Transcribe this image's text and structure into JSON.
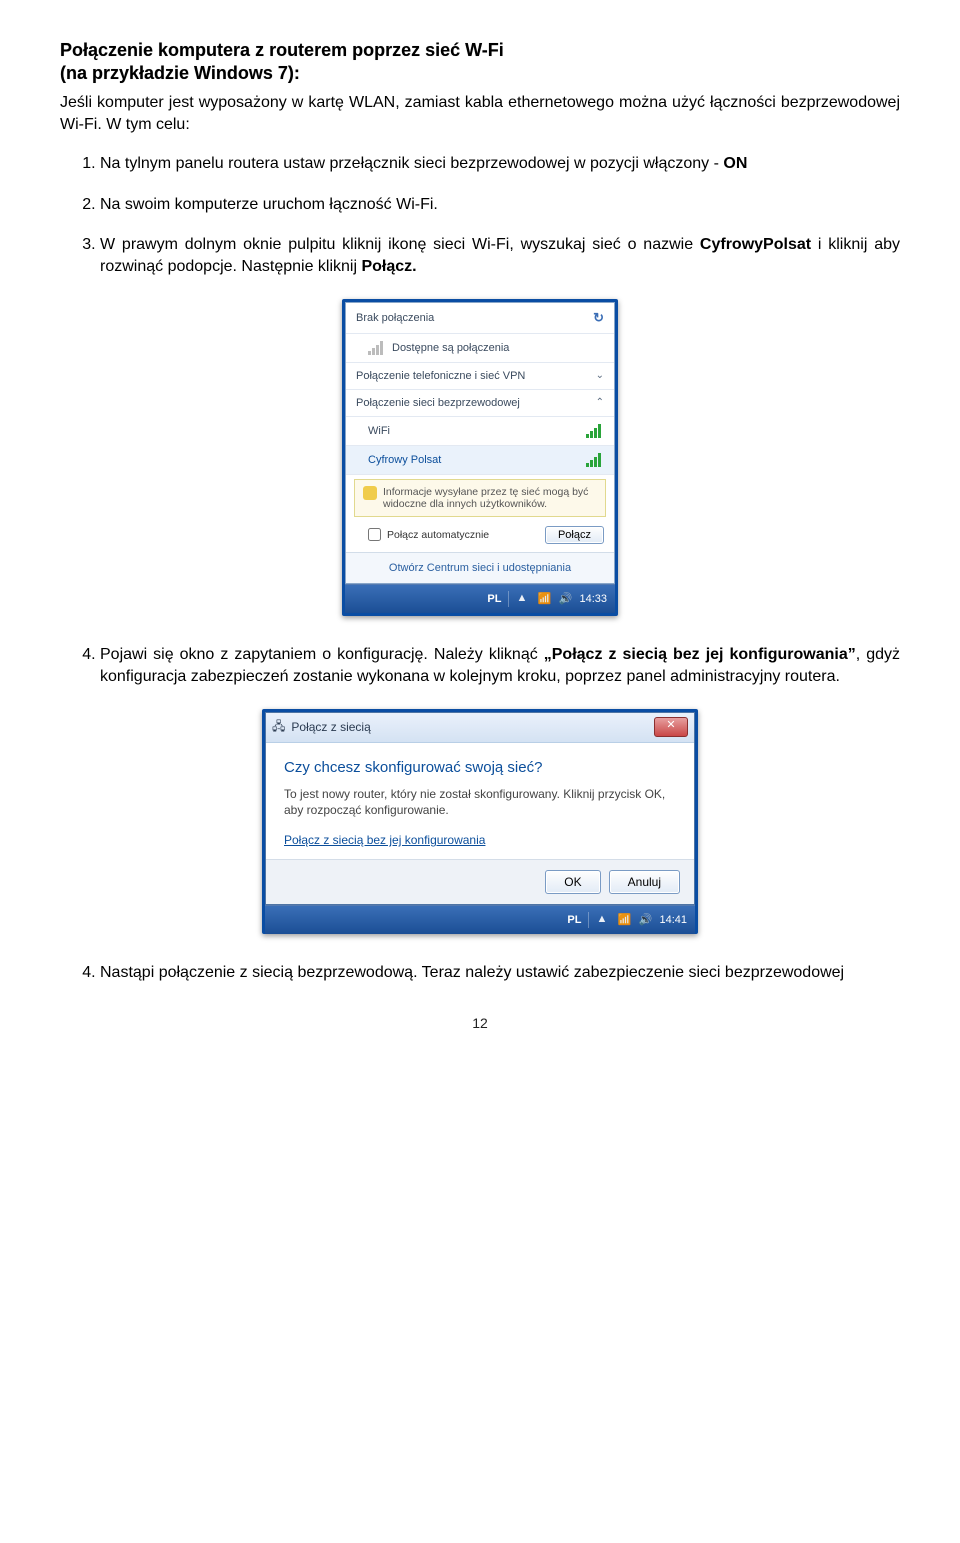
{
  "heading": "Połączenie komputera z routerem poprzez sieć W-Fi",
  "subheading": "(na przykładzie Windows 7):",
  "intro": "Jeśli komputer jest wyposażony w kartę WLAN, zamiast kabla ethernetowego można użyć łączności bezprzewodowej Wi-Fi. W tym celu:",
  "steps": {
    "s1a": "Na tylnym panelu routera ustaw przełącznik sieci bezprzewodowej w pozycji włączony - ",
    "s1b": "ON",
    "s2": "Na swoim komputerze uruchom łączność Wi-Fi.",
    "s3a": "W prawym dolnym oknie pulpitu kliknij ikonę sieci Wi-Fi, wyszukaj sieć o nazwie ",
    "s3b": "CyfrowyPolsat",
    "s3c": " i kliknij aby rozwinąć podopcje. Następnie kliknij ",
    "s3d": "Połącz.",
    "s4a": "Pojawi się okno z zapytaniem o konfigurację. Należy kliknąć ",
    "s4b": "„Połącz z siecią bez jej konfigurowania”",
    "s4c": ", gdyż konfiguracja zabezpieczeń zostanie wykonana w kolejnym kroku, poprzez panel administracyjny routera.",
    "s5": "Nastąpi połączenie z siecią bezprzewodową. Teraz należy ustawić zabezpieczenie sieci bezprzewodowej"
  },
  "popup1": {
    "no_conn": "Brak połączenia",
    "available": "Dostępne są połączenia",
    "dial_vpn": "Połączenie telefoniczne i sieć VPN",
    "wireless_section": "Połączenie sieci bezprzewodowej",
    "wifi": "WiFi",
    "network_name": "Cyfrowy Polsat",
    "warning": "Informacje wysyłane przez tę sieć mogą być widoczne dla innych użytkowników.",
    "auto_connect": "Połącz automatycznie",
    "connect_btn": "Połącz",
    "footer": "Otwórz Centrum sieci i udostępniania",
    "lang": "PL",
    "time": "14:33"
  },
  "popup2": {
    "title": "Połącz z siecią",
    "question": "Czy chcesz skonfigurować swoją sieć?",
    "msg": "To jest nowy router, który nie został skonfigurowany. Kliknij przycisk OK, aby rozpocząć konfigurowanie.",
    "link": "Połącz z siecią bez jej konfigurowania",
    "ok": "OK",
    "cancel": "Anuluj",
    "lang": "PL",
    "time": "14:41"
  },
  "page_number": "12"
}
